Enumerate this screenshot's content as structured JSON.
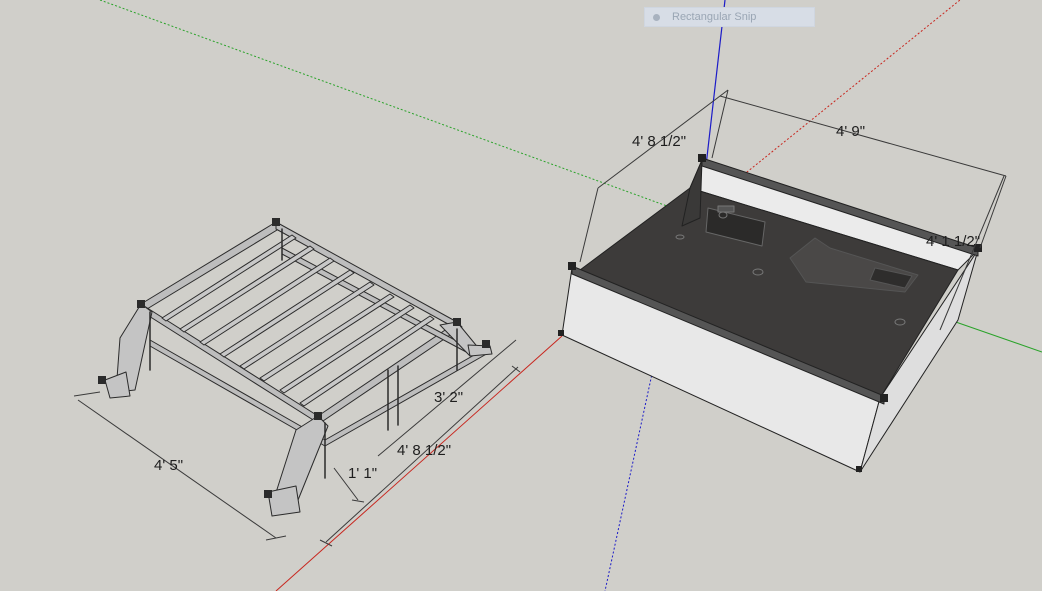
{
  "app": {
    "tooltip": {
      "label": "Rectangular Snip",
      "icon": "snip-icon"
    }
  },
  "colors": {
    "background": "#d0cfca",
    "axis_red": "#c8261e",
    "axis_green": "#2aa32a",
    "axis_blue": "#1c1cc8",
    "frame_stroke": "#2b2b2b",
    "bed_floor": "#3d3b3a",
    "bed_walls": "#e8e8e8"
  },
  "scene": {
    "models": [
      {
        "name": "rack-frame",
        "label": ""
      },
      {
        "name": "truck-bed",
        "label": ""
      }
    ],
    "rack_dimensions": {
      "width": "4' 5\"",
      "length": "4' 8 1/2\"",
      "side_length": "3' 2\"",
      "leg_height": "1' 1\""
    },
    "bed_dimensions": {
      "height": "4' 8 1/2\"",
      "length": "4' 9\"",
      "depth": "4' 1 1/2\""
    }
  }
}
